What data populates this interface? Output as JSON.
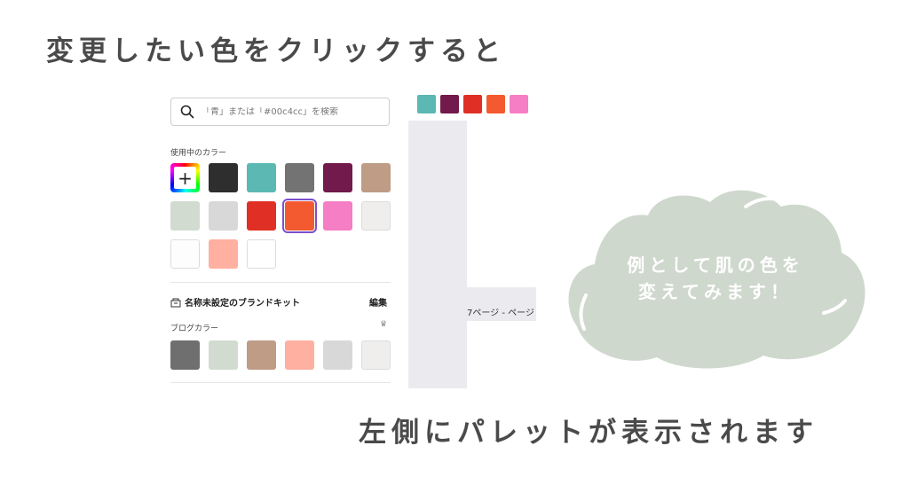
{
  "headline": "変更したい色をクリックすると",
  "footer_caption": "左側にパレットが表示されます",
  "callout": {
    "line1": "例として肌の色を",
    "line2": "変えてみます！"
  },
  "palette": {
    "search_placeholder": "「青」または「#00c4cc」を検索",
    "used_colors_label": "使用中のカラー",
    "used_colors": [
      "#2e2e2e",
      "#5bb8b2",
      "#737373",
      "#711a4b",
      "#bf9c86",
      "#d1dbd0",
      "#d8d8d8",
      "#e03025",
      "#f45a30",
      "#f57ec4",
      "#f0eeec",
      "#fdfdfd",
      "#ffb0a0",
      "#ffffff"
    ],
    "brand_kit_title": "名称未設定のブランドキット",
    "brand_kit_edit": "編集",
    "blog_colors_label": "ブログカラー",
    "blog_colors": [
      "#6f6f6f",
      "#d1dbd0",
      "#bf9c86",
      "#ffb0a0",
      "#d8d8d8",
      "#f0eeec"
    ]
  },
  "canvas": {
    "toolbar_colors": [
      "#5bb8b2",
      "#711a4b",
      "#e03025",
      "#f45a30",
      "#f57ec4"
    ],
    "page_label": "7ページ - ページ"
  },
  "colors": {
    "cloud": "#cfd8cd",
    "selected_outline": "#7b4fcf"
  }
}
